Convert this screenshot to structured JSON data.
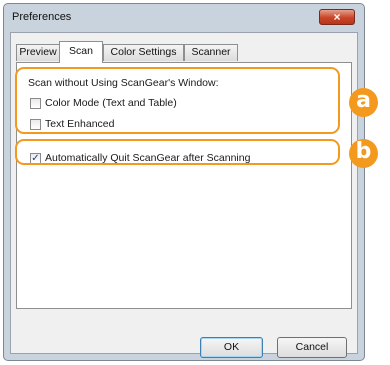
{
  "window": {
    "title": "Preferences",
    "close_glyph": "×"
  },
  "tabs": [
    {
      "label": "Preview",
      "active": false
    },
    {
      "label": "Scan",
      "active": true
    },
    {
      "label": "Color Settings",
      "active": false
    },
    {
      "label": "Scanner",
      "active": false
    }
  ],
  "scan_panel": {
    "group_label": "Scan without Using ScanGear's Window:",
    "options": [
      {
        "label": "Color Mode (Text and Table)",
        "checked": false
      },
      {
        "label": "Text Enhanced",
        "checked": false
      }
    ],
    "auto_quit": {
      "label": "Automatically Quit ScanGear after Scanning",
      "checked": true
    }
  },
  "callouts": {
    "a": "a",
    "b": "b",
    "color": "#f39a1e"
  },
  "buttons": {
    "ok": "OK",
    "cancel": "Cancel"
  }
}
